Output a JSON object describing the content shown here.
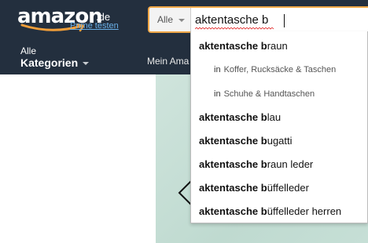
{
  "logo": {
    "word": "amazon",
    "tld": ".de"
  },
  "prime_link": "Prime testen",
  "categories": {
    "small": "Alle",
    "big": "Kategorien"
  },
  "nav": {
    "mein_account_truncated": "Mein Ama"
  },
  "search": {
    "department": "Alle",
    "query": "aktentasche b"
  },
  "suggestions": [
    {
      "prefix": "aktentasche ",
      "rest": "b",
      "suffix": "raun"
    },
    {
      "scope_prefix": "in",
      "scope": "Koffer, Rucksäcke & Taschen"
    },
    {
      "scope_prefix": "in",
      "scope": "Schuhe & Handtaschen"
    },
    {
      "prefix": "aktentasche ",
      "rest": "b",
      "suffix": "lau"
    },
    {
      "prefix": "aktentasche ",
      "rest": "b",
      "suffix": "ugatti"
    },
    {
      "prefix": "aktentasche ",
      "rest": "b",
      "suffix": "raun leder"
    },
    {
      "prefix": "aktentasche ",
      "rest": "b",
      "suffix": "üffelleder"
    },
    {
      "prefix": "aktentasche ",
      "rest": "b",
      "suffix": "üffelleder herren"
    }
  ],
  "colors": {
    "navbar": "#232f3e",
    "search_focus_border": "#f0a848",
    "prime_link": "#6ab0e8",
    "logo_smile": "#f19e39"
  },
  "icons": [
    "amazon-smile-logo",
    "chevron-down-icon",
    "carousel-left-arrow-icon"
  ]
}
